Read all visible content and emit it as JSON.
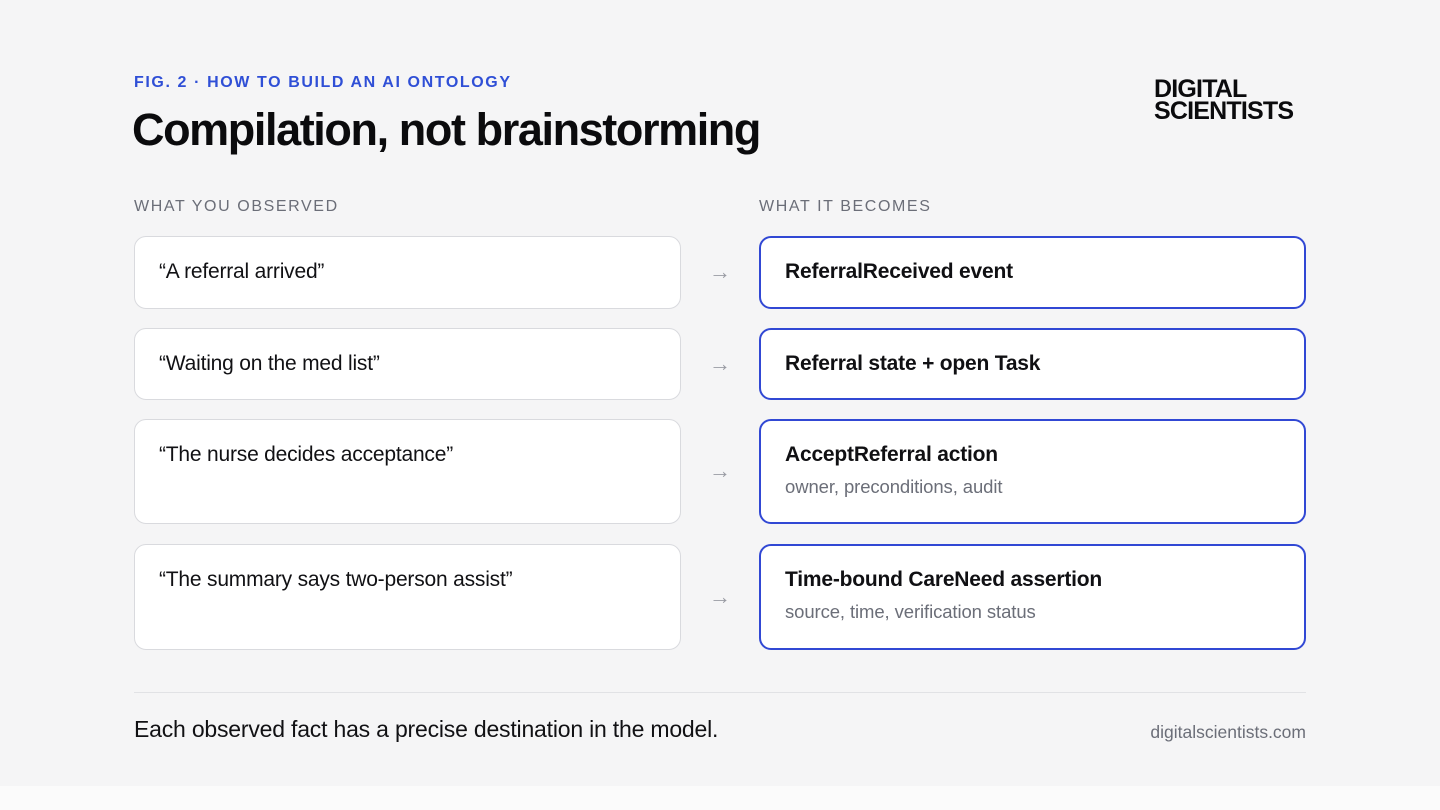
{
  "header": {
    "eyebrow": "FIG. 2 · HOW TO BUILD AN AI ONTOLOGY",
    "title": "Compilation, not brainstorming",
    "logo_line1": "DIGITAL",
    "logo_line2": "SCIENTISTS"
  },
  "columns": {
    "left_label": "WHAT YOU OBSERVED",
    "right_label": "WHAT IT BECOMES"
  },
  "rows": [
    {
      "observed": "“A referral arrived”",
      "result_title": "ReferralReceived event",
      "result_sub": ""
    },
    {
      "observed": "“Waiting on the med list”",
      "result_title": "Referral state + open Task",
      "result_sub": ""
    },
    {
      "observed": "“The nurse decides acceptance”",
      "result_title": "AcceptReferral action",
      "result_sub": "owner, preconditions, audit"
    },
    {
      "observed": "“The summary says two-person assist”",
      "result_title": "Time-bound CareNeed assertion",
      "result_sub": "source, time, verification status"
    }
  ],
  "arrow_glyph": "→",
  "footer": {
    "note": "Each observed fact has a precise destination in the model.",
    "url": "digitalscientists.com"
  },
  "colors": {
    "accent": "#3148d4",
    "eyebrow": "#2f4fd6",
    "muted": "#6b6e78",
    "background": "#f5f5f6"
  }
}
